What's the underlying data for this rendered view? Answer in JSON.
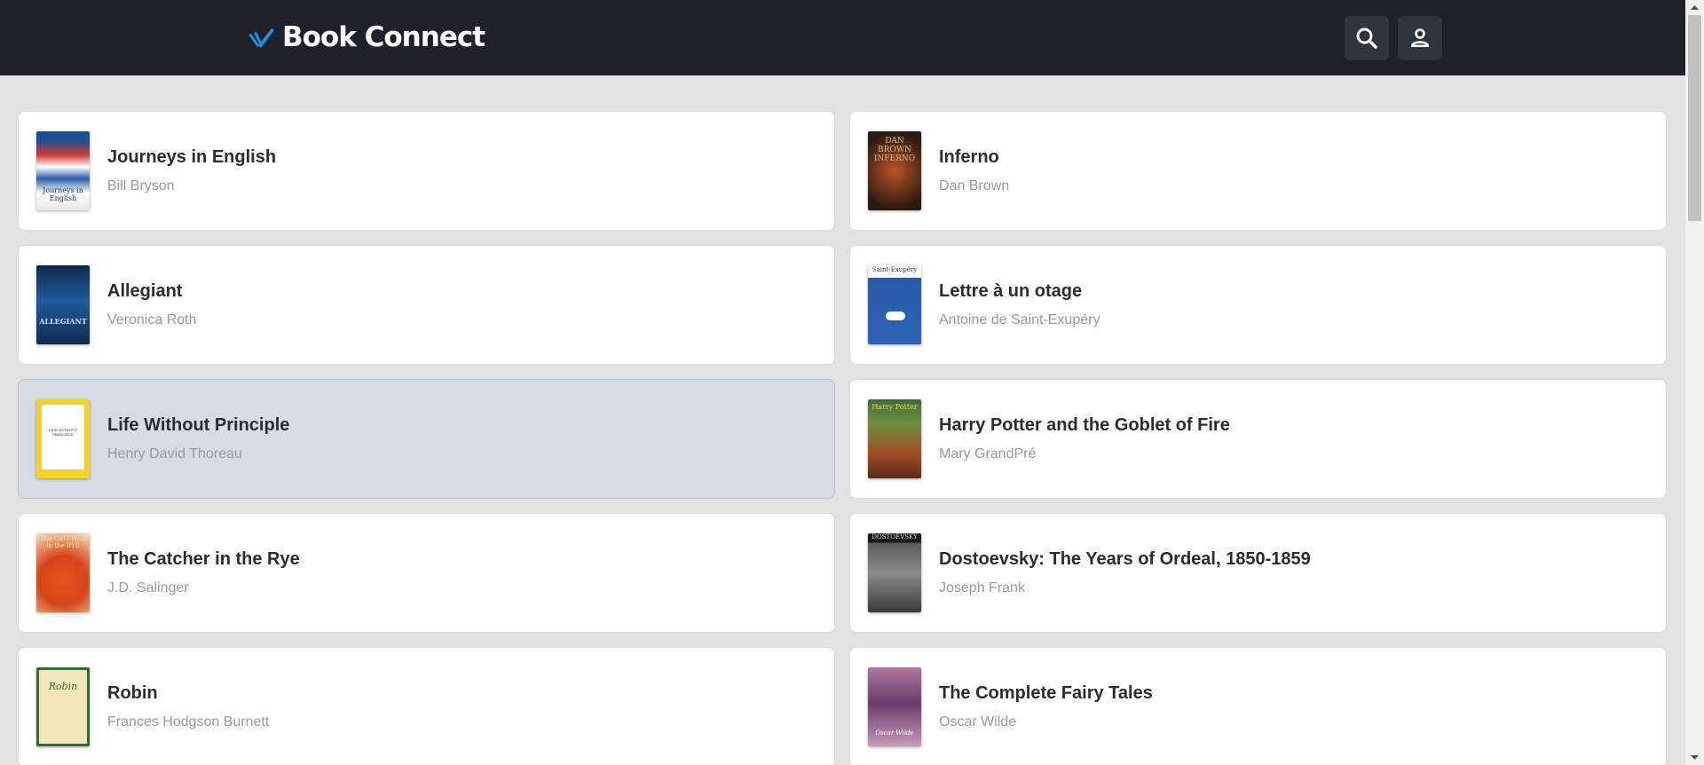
{
  "app": {
    "name": "Book Connect",
    "logo_icon": "book-connect-logo-icon",
    "accent_color": "#1e8fe8"
  },
  "header": {
    "search_icon": "search-icon",
    "account_icon": "person-icon"
  },
  "books": [
    {
      "title": "Journeys in English",
      "author": "Bill Bryson",
      "cover_text": "Journeys in English"
    },
    {
      "title": "Inferno",
      "author": "Dan Brown",
      "cover_text": "DAN BROWN INFERNO"
    },
    {
      "title": "Allegiant",
      "author": "Veronica Roth",
      "cover_text": "ALLEGIANT"
    },
    {
      "title": "Lettre à un otage",
      "author": "Antoine de Saint-Exupéry",
      "cover_text": "Saint-Exupéry"
    },
    {
      "title": "Life Without Principle",
      "author": "Henry David Thoreau",
      "cover_text": "LIFE WITHOUT PRINCIPLE"
    },
    {
      "title": "Harry Potter and the Goblet of Fire",
      "author": "Mary GrandPré",
      "cover_text": "Harry Potter"
    },
    {
      "title": "The Catcher in the Rye",
      "author": "J.D. Salinger",
      "cover_text": "The CATCHER in the RYE"
    },
    {
      "title": "Dostoevsky: The Years of Ordeal, 1850-1859",
      "author": "Joseph Frank",
      "cover_text": "DOSTOEVSKY"
    },
    {
      "title": "Robin",
      "author": "Frances Hodgson Burnett",
      "cover_text": "Robin"
    },
    {
      "title": "The Complete Fairy Tales",
      "author": "Oscar Wilde",
      "cover_text": "Oscar Wilde"
    }
  ],
  "selected_book": "Life Without Principle"
}
